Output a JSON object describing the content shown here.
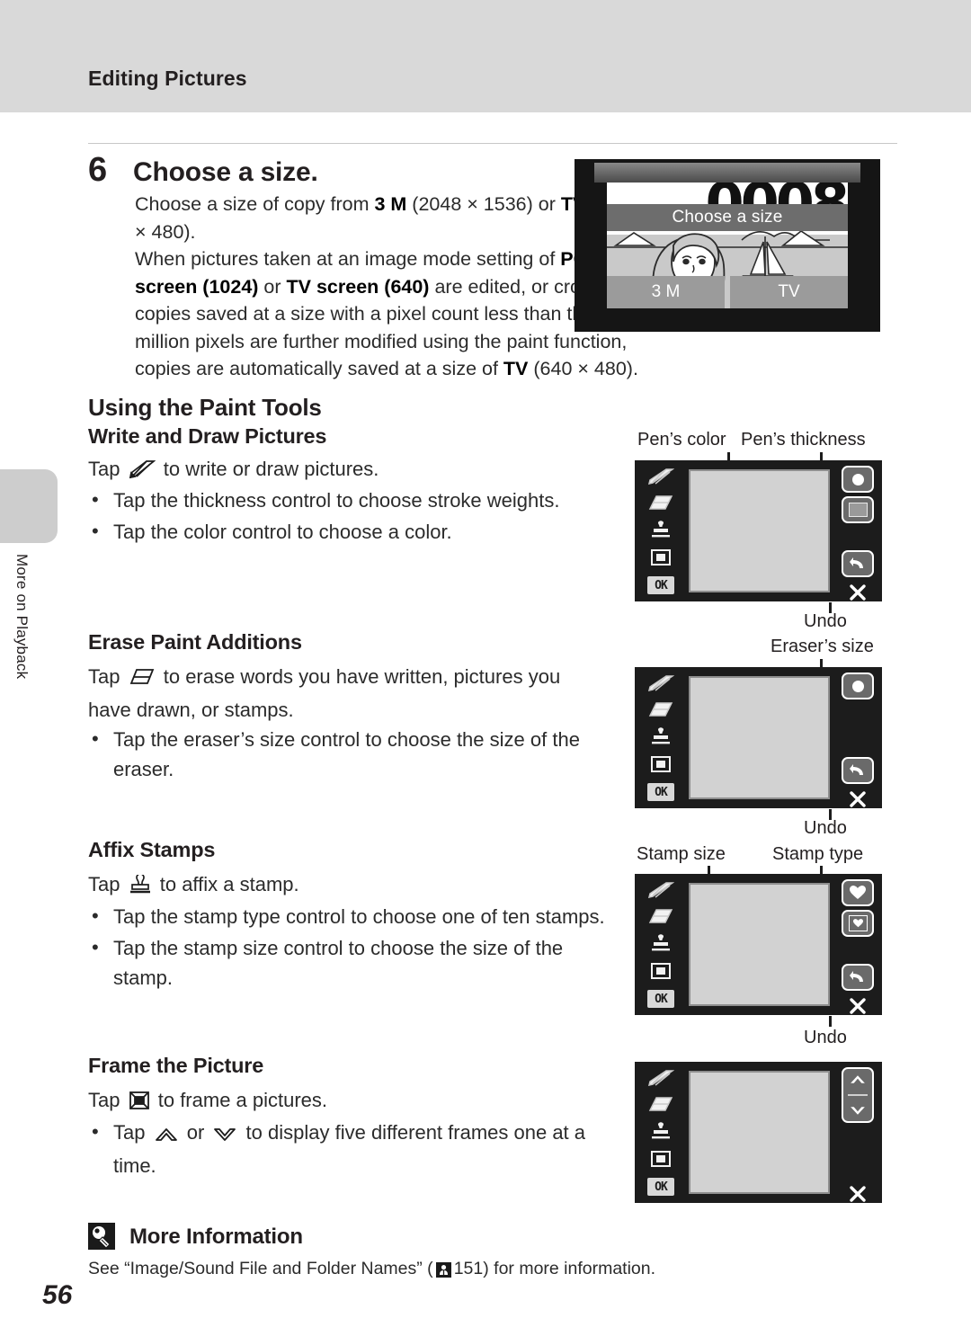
{
  "header": {
    "title": "Editing Pictures"
  },
  "side_tab": {
    "label": "More on Playback"
  },
  "step": {
    "number": "6",
    "title": "Choose a size.",
    "body_html": "Choose a size of copy from <b>3 M</b> (2048 × 1536) or <b>TV</b> (640 × 480).<br>When pictures taken at an image mode setting of <b>PC screen (1024)</b> or <b>TV screen (640)</b> are edited, or cropped copies saved at a size with a pixel count less than three million pixels are further modified using the paint function, copies are automatically saved at a size of <b>TV</b> (640 × 480)."
  },
  "lcd_photo": {
    "big_number": "0008",
    "header_label": "Choose a size",
    "button_left": "3 M",
    "button_right": "TV"
  },
  "sections": {
    "using_paint_tools": "Using the Paint Tools",
    "write_and_draw": {
      "heading": "Write and Draw Pictures",
      "intro_prefix": "Tap",
      "intro_suffix": "to write or draw pictures.",
      "bullets": [
        "Tap the thickness control to choose stroke weights.",
        "Tap the color control to choose a color."
      ]
    },
    "erase_paint": {
      "heading": "Erase Paint Additions",
      "intro_prefix": "Tap",
      "intro_suffix": "to erase words you have written, pictures you have drawn, or stamps.",
      "bullets": [
        "Tap the eraser’s size control to choose the size of the eraser."
      ]
    },
    "affix_stamps": {
      "heading": "Affix Stamps",
      "intro_prefix": "Tap",
      "intro_suffix": "to affix a stamp.",
      "bullets": [
        "Tap the stamp type control to choose one of ten stamps.",
        "Tap the stamp size control to choose the size of the stamp."
      ]
    },
    "frame_picture": {
      "heading": "Frame the Picture",
      "intro_prefix": "Tap",
      "intro_suffix": "to frame a pictures.",
      "bullet_prefix": "Tap",
      "bullet_mid": "or",
      "bullet_suffix": "to display five different frames one at a time."
    }
  },
  "callouts": {
    "pens_color": "Pen’s color",
    "pens_thickness": "Pen’s thickness",
    "undo_1": "Undo",
    "erasers_size": "Eraser’s size",
    "undo_2": "Undo",
    "stamp_size": "Stamp size",
    "stamp_type": "Stamp type",
    "undo_3": "Undo"
  },
  "more_information": {
    "title": "More Information",
    "text_prefix": "See “Image/Sound File and Folder Names” (",
    "page_ref": "151",
    "text_suffix": ") for more information."
  },
  "page_number": "56",
  "colors": {
    "header_band": "#d9d9d9",
    "side_tab": "#cdcdcd",
    "screen_body": "#1c1c1c",
    "canvas": "#d2d2d2",
    "text": "#231f20"
  }
}
